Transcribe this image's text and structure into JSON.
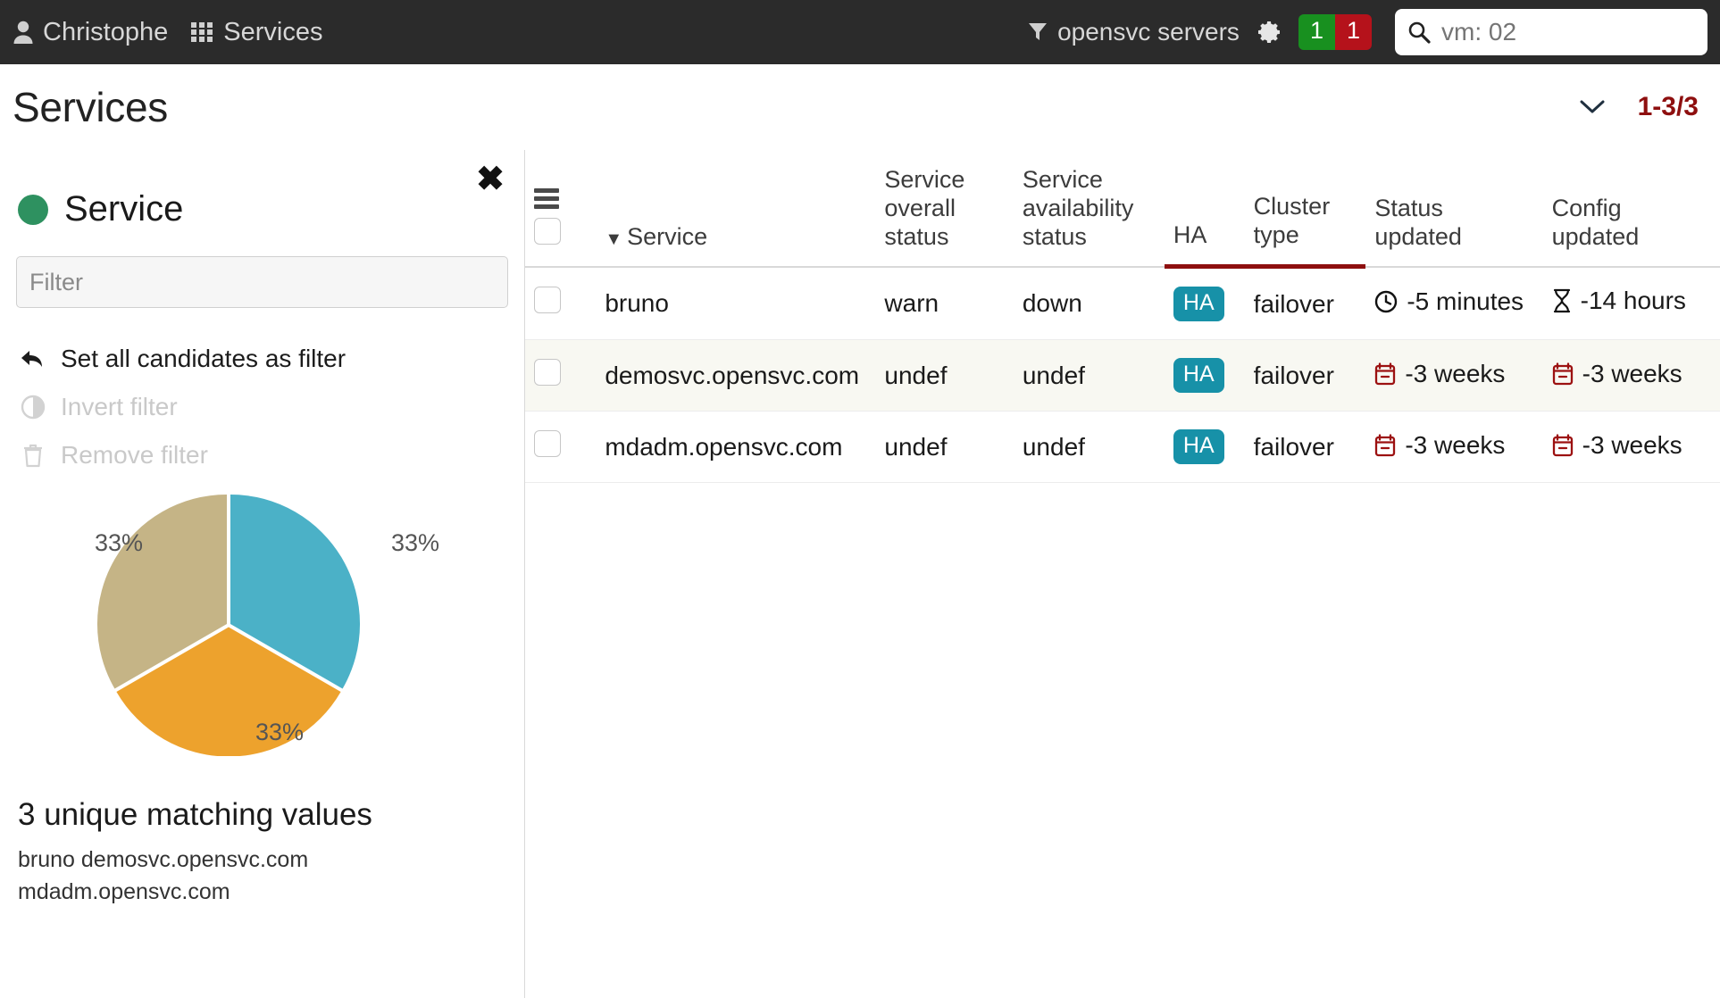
{
  "topbar": {
    "user": {
      "label": "Christophe",
      "icon": "user-icon"
    },
    "apps": {
      "label": "Services",
      "icon": "grid-icon"
    },
    "server_filter": {
      "label": "opensvc servers",
      "icon": "filter-icon"
    },
    "gear": {
      "icon": "gear-icon"
    },
    "badge_ok": "1",
    "badge_err": "1",
    "search": {
      "placeholder": "vm: 02",
      "value": "vm: 02",
      "icon": "search-icon"
    }
  },
  "page": {
    "title": "Services",
    "chevron_icon": "chevron-down-icon",
    "pagination": "1-3/3"
  },
  "panel": {
    "close_icon": "close-icon",
    "status_dot_color": "#2e9160",
    "title": "Service",
    "filter_placeholder": "Filter",
    "filter_value": "",
    "actions": [
      {
        "label": "Set all candidates as filter",
        "icon": "reply-arrow-icon",
        "disabled": false
      },
      {
        "label": "Invert filter",
        "icon": "adjust-icon",
        "disabled": true
      },
      {
        "label": "Remove filter",
        "icon": "trash-icon",
        "disabled": true
      }
    ],
    "summary_count": "3 unique matching values",
    "summary_values": "bruno  demosvc.opensvc.com  mdadm.opensvc.com"
  },
  "chart_data": {
    "type": "pie",
    "title": "",
    "categories": [
      "bruno",
      "demosvc.opensvc.com",
      "mdadm.opensvc.com"
    ],
    "values": [
      33,
      33,
      33
    ],
    "labels": [
      "33%",
      "33%",
      "33%"
    ],
    "colors": [
      "#4bb1c7",
      "#eda22d",
      "#c5b486"
    ],
    "label_positions": [
      "right",
      "bottom",
      "left"
    ],
    "legend": "none",
    "start_angle_deg": 0
  },
  "table": {
    "menu_icon": "hamburger-icon",
    "select_all_checkbox": false,
    "columns": [
      {
        "key": "checkbox",
        "label": ""
      },
      {
        "key": "service",
        "label": "Service",
        "sorted": true,
        "sort_icon": "caret-down-icon"
      },
      {
        "key": "overall",
        "label": "Service overall status"
      },
      {
        "key": "availability",
        "label": "Service availability status"
      },
      {
        "key": "ha",
        "label": "HA",
        "highlighted": true
      },
      {
        "key": "cluster_type",
        "label": "Cluster type",
        "highlighted": true
      },
      {
        "key": "status_updated",
        "label": "Status updated"
      },
      {
        "key": "config_updated",
        "label": "Config updated"
      }
    ],
    "rows": [
      {
        "checked": false,
        "service": "bruno",
        "overall": "warn",
        "overall_state": "warn",
        "availability": "down",
        "availability_state": "down",
        "ha": "HA",
        "cluster_type": "failover",
        "status_updated": "-5 minutes",
        "status_updated_icon": "clock-icon",
        "status_updated_color": "#1a1a1a",
        "config_updated": "-14 hours",
        "config_updated_icon": "hourglass-icon",
        "config_updated_color": "#1a1a1a",
        "highlight": false
      },
      {
        "checked": false,
        "service": "demosvc.opensvc.com",
        "overall": "undef",
        "overall_state": "undef",
        "availability": "undef",
        "availability_state": "undef",
        "ha": "HA",
        "cluster_type": "failover",
        "status_updated": "-3 weeks",
        "status_updated_icon": "calendar-minus-icon",
        "status_updated_color": "#9c1111",
        "config_updated": "-3 weeks",
        "config_updated_icon": "calendar-minus-icon",
        "config_updated_color": "#9c1111",
        "highlight": true
      },
      {
        "checked": false,
        "service": "mdadm.opensvc.com",
        "overall": "undef",
        "overall_state": "undef",
        "availability": "undef",
        "availability_state": "undef",
        "ha": "HA",
        "cluster_type": "failover",
        "status_updated": "-3 weeks",
        "status_updated_icon": "calendar-minus-icon",
        "status_updated_color": "#9c1111",
        "config_updated": "-3 weeks",
        "config_updated_icon": "calendar-minus-icon",
        "config_updated_color": "#9c1111",
        "highlight": false
      }
    ]
  },
  "colors": {
    "topbar_bg": "#2b2b2b",
    "accent_red": "#8e0f0f",
    "ha_teal": "#1791a8",
    "ok_green": "#18901f",
    "err_red": "#b5121b",
    "warn_orange": "#e8911b",
    "down_red": "#9c1111",
    "row_highlight": "#f8f8f2"
  }
}
